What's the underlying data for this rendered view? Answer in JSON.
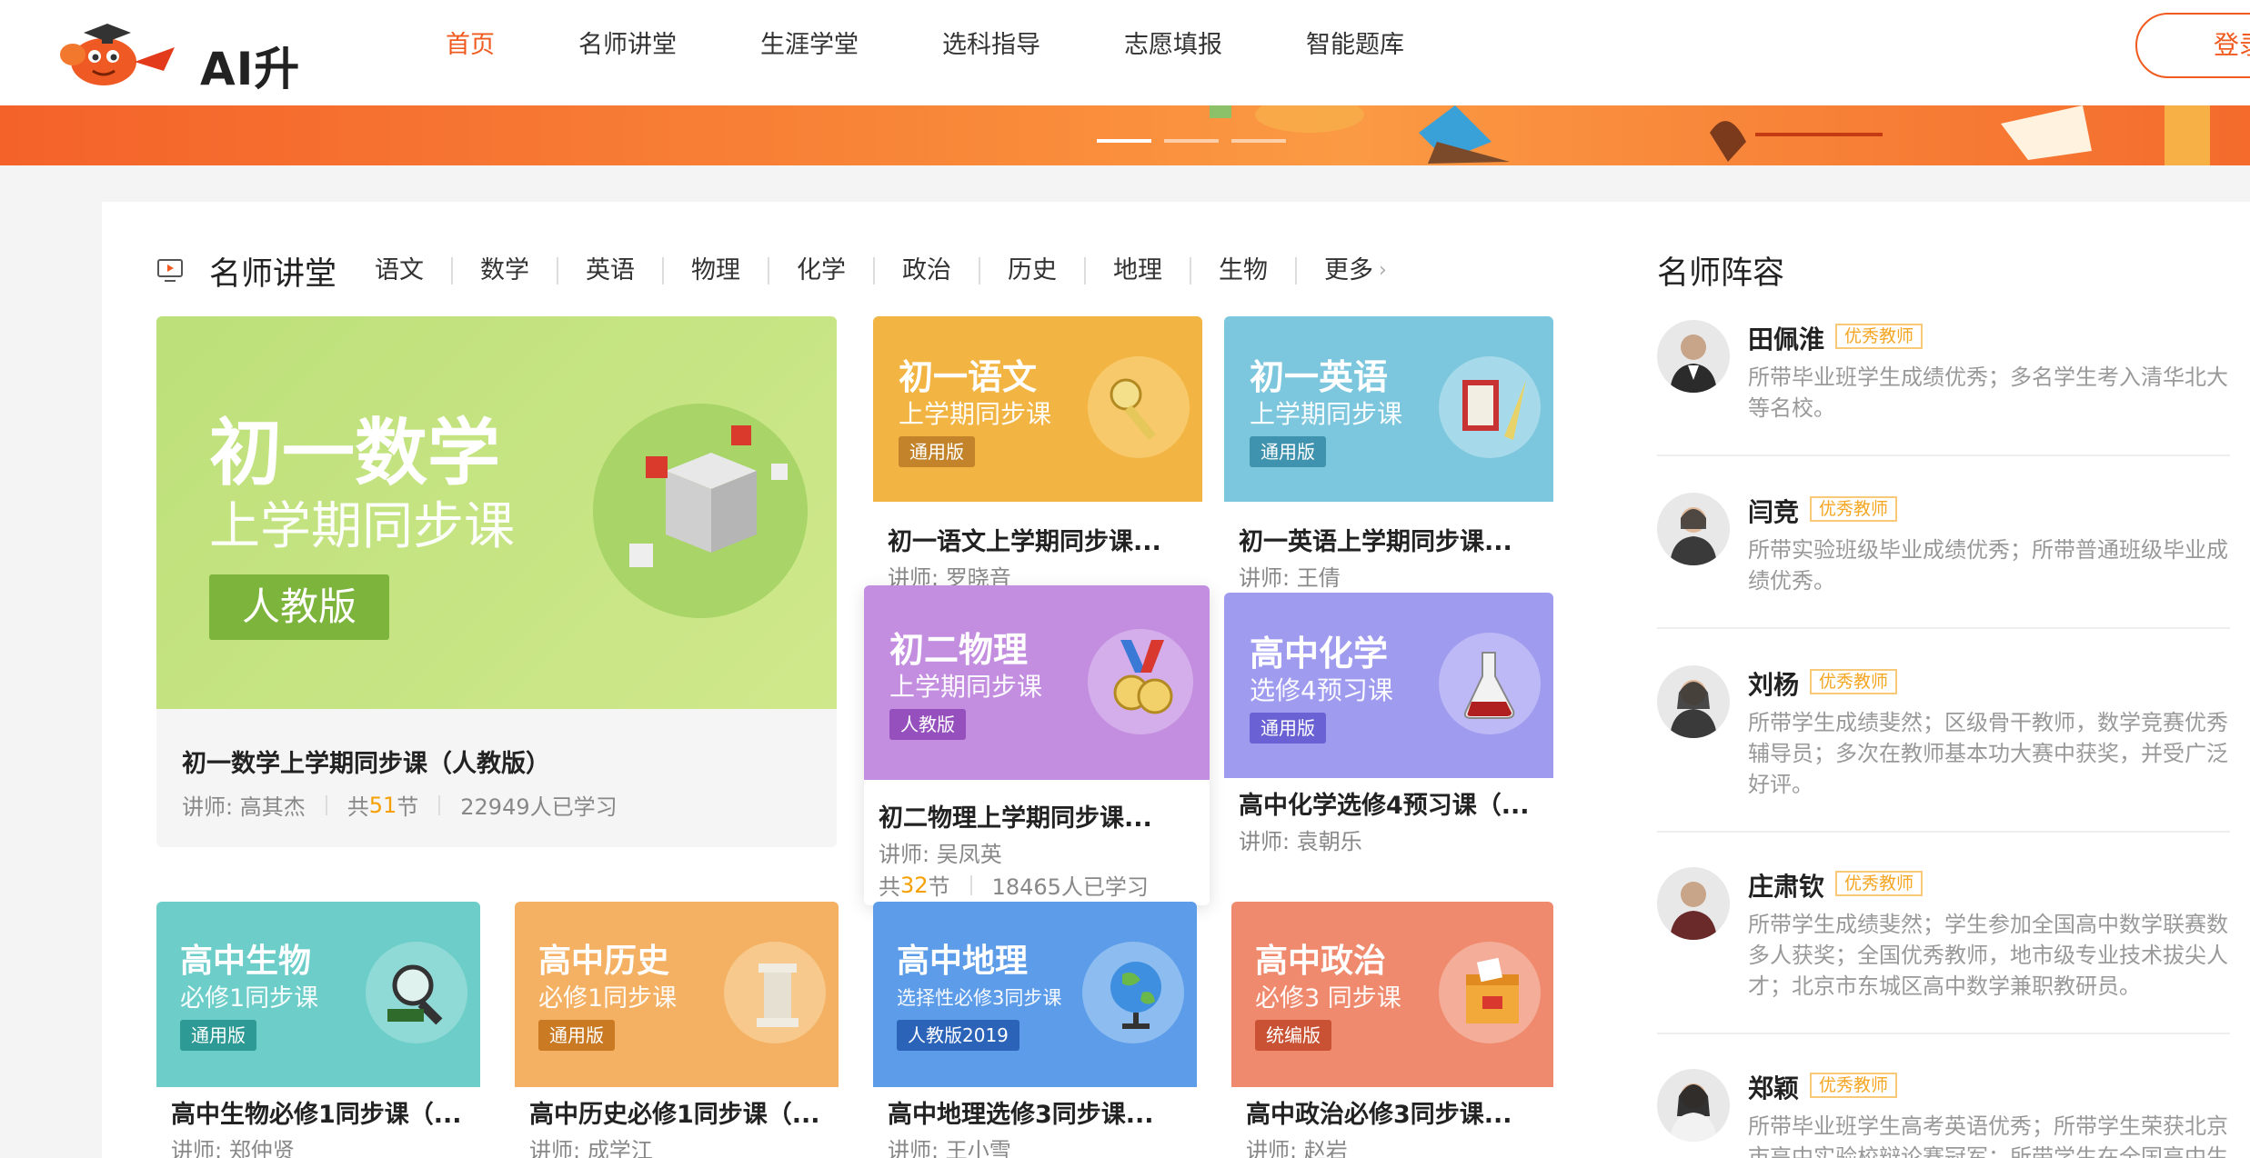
{
  "brand": {
    "name": "AI升学宝"
  },
  "nav": {
    "items": [
      "首页",
      "名师讲堂",
      "生涯学堂",
      "选科指导",
      "志愿填报",
      "智能题库"
    ],
    "active": 0,
    "login": "登录"
  },
  "section": {
    "title": "名师讲堂",
    "tabs": [
      "语文",
      "数学",
      "英语",
      "物理",
      "化学",
      "政治",
      "历史",
      "地理",
      "生物"
    ],
    "more": "更多"
  },
  "featured": {
    "cover_title": "初一数学",
    "cover_sub": "上学期同步课",
    "cover_badge": "人教版",
    "name": "初一数学上学期同步课（人教版）",
    "teacher": "讲师: 高其杰",
    "lessons_prefix": "共",
    "lessons": "51",
    "lessons_suffix": "节",
    "learners": "22949人已学习"
  },
  "courses": [
    {
      "cover_title": "初一语文",
      "cover_sub": "上学期同步课",
      "badge": "通用版",
      "name": "初一语文上学期同步课...",
      "teacher": "讲师: 罗晓音",
      "color": "#f2b543"
    },
    {
      "cover_title": "初一英语",
      "cover_sub": "上学期同步课",
      "badge": "通用版",
      "name": "初一英语上学期同步课...",
      "teacher": "讲师: 王倩",
      "color": "#7cc7dd"
    },
    {
      "cover_title": "初二物理",
      "cover_sub": "上学期同步课",
      "badge": "人教版",
      "name": "初二物理上学期同步课...",
      "teacher": "讲师: 吴凤英",
      "lessons_prefix": "共",
      "lessons": "32",
      "lessons_suffix": "节",
      "learners": "18465人已学习",
      "color": "#c38ee0"
    },
    {
      "cover_title": "高中化学",
      "cover_sub": "选修4预习课",
      "badge": "通用版",
      "name": "高中化学选修4预习课（...",
      "teacher": "讲师: 袁朝乐",
      "color": "#9f9bef"
    },
    {
      "cover_title": "高中生物",
      "cover_sub": "必修1同步课",
      "badge": "通用版",
      "name": "高中生物必修1同步课（...",
      "teacher": "讲师: 郑仲贤",
      "color": "#6ccdc9"
    },
    {
      "cover_title": "高中历史",
      "cover_sub": "必修1同步课",
      "badge": "通用版",
      "name": "高中历史必修1同步课（...",
      "teacher": "讲师: 成学江",
      "color": "#f4b163"
    },
    {
      "cover_title": "高中地理",
      "cover_sub": "选择性必修3同步课",
      "badge": "人教版2019",
      "name": "高中地理选修3同步课...",
      "teacher": "讲师: 王小雪",
      "color": "#5c9ce8"
    },
    {
      "cover_title": "高中政治",
      "cover_sub": "必修3 同步课",
      "badge": "统编版",
      "name": "高中政治必修3同步课...",
      "teacher": "讲师: 赵岩",
      "color": "#ef8a6e"
    }
  ],
  "teachers": {
    "title": "名师阵容",
    "tag": "优秀教师",
    "list": [
      {
        "name": "田佩淮",
        "desc": "所带毕业班学生成绩优秀；多名学生考入清华北大等名校。"
      },
      {
        "name": "闫竞",
        "desc": "所带实验班级毕业成绩优秀；所带普通班级毕业成绩优秀。"
      },
      {
        "name": "刘杨",
        "desc": "所带学生成绩斐然；区级骨干教师，数学竞赛优秀辅导员；多次在教师基本功大赛中获奖，并受广泛好评。"
      },
      {
        "name": "庄肃钦",
        "desc": "所带学生成绩斐然；学生参加全国高中数学联赛数多人获奖；全国优秀教师，地市级专业技术拔尖人才；北京市东城区高中数学兼职教研员。"
      },
      {
        "name": "郑颖",
        "desc": "所带毕业班学生高考英语优秀；所带学生荣获北京市高中实验校辩论赛冠军；所带学生在全国高中生"
      }
    ]
  }
}
